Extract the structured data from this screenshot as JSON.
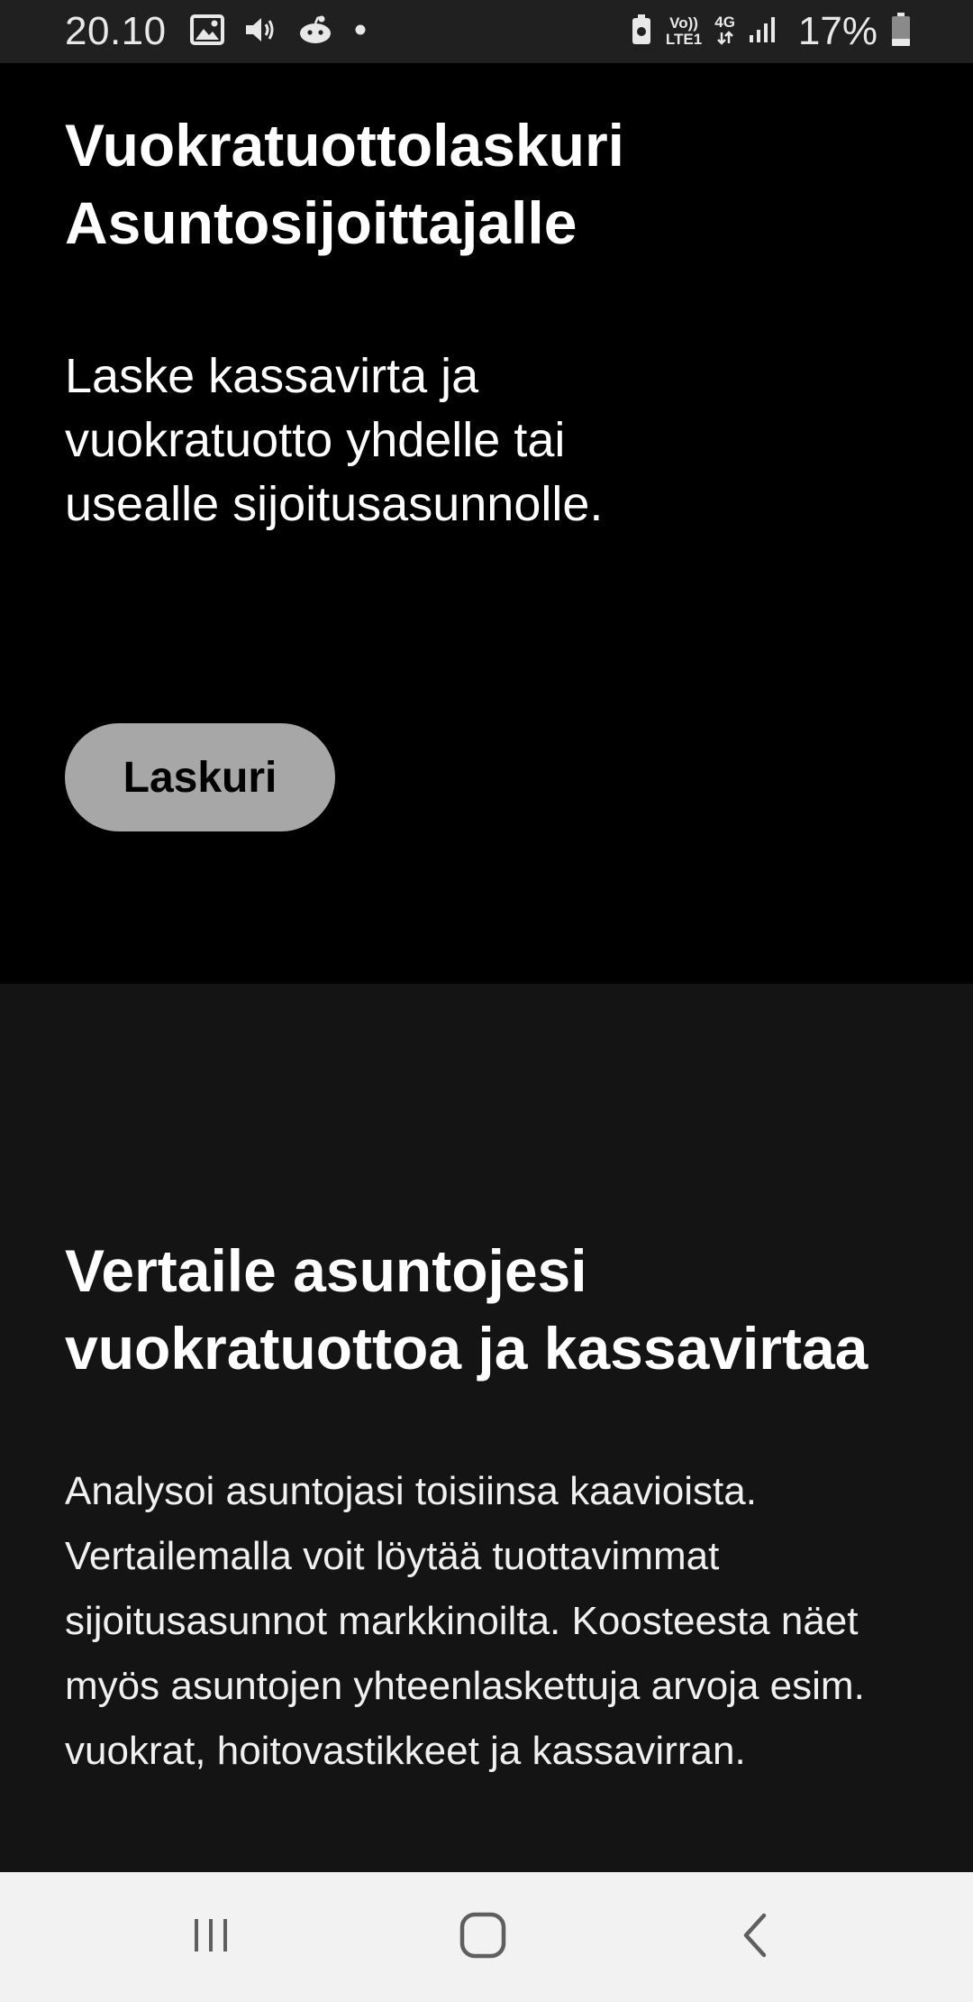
{
  "status_bar": {
    "time": "20.10",
    "network_top": "Vo))",
    "network_bottom": "LTE1",
    "data_type": "4G",
    "battery_percent": "17%",
    "icons": [
      "image-icon",
      "volume-icon",
      "reddit-icon",
      "dot-icon",
      "battery-saver-icon",
      "signal-icon",
      "battery-icon"
    ]
  },
  "hero": {
    "title_line1": "Vuokratuottolaskuri",
    "title_line2": "Asuntosijoittajalle",
    "subtitle": "Laske kassavirta ja vuokratuotto yhdelle tai usealle sijoitusasunnolle.",
    "button_label": "Laskuri"
  },
  "compare": {
    "title": "Vertaile asuntojesi vuokratuottoa ja kassavirtaa",
    "body": "Analysoi asuntojasi toisiinsa kaavioista. Vertailemalla voit löytää tuottavimmat sijoitusasunnot markkinoilta. Koosteesta näet myös asuntojen yhteenlaskettuja arvoja esim. vuokrat, hoitovastikkeet ja kassavirran."
  },
  "nav_bar": {
    "icons": [
      "recent-apps-icon",
      "home-icon",
      "back-icon"
    ]
  },
  "colors": {
    "status_bar_bg": "#202020",
    "hero_bg": "#000000",
    "compare_bg": "#141414",
    "button_bg": "#a7a7a7",
    "nav_bar_bg": "#f2f2f2"
  }
}
